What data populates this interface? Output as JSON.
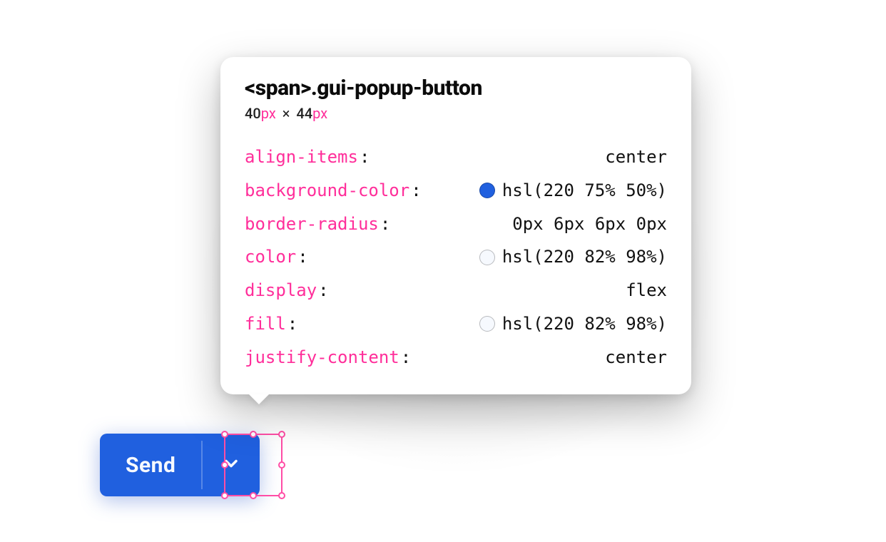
{
  "button": {
    "main_label": "Send"
  },
  "inspector": {
    "selector": "<span>.gui-popup-button",
    "dimensions": {
      "w": "40",
      "h": "44",
      "unit": "px"
    },
    "properties": [
      {
        "name": "align-items",
        "value": "center"
      },
      {
        "name": "background-color",
        "value": "hsl(220 75% 50%)",
        "swatch": "hsl(220 75% 50%)"
      },
      {
        "name": "border-radius",
        "value": "0px 6px 6px 0px"
      },
      {
        "name": "color",
        "value": "hsl(220 82% 98%)",
        "swatch": "hsl(220 82% 98%)"
      },
      {
        "name": "display",
        "value": "flex"
      },
      {
        "name": "fill",
        "value": "hsl(220 82% 98%)",
        "swatch": "hsl(220 82% 98%)"
      },
      {
        "name": "justify-content",
        "value": "center"
      }
    ]
  }
}
